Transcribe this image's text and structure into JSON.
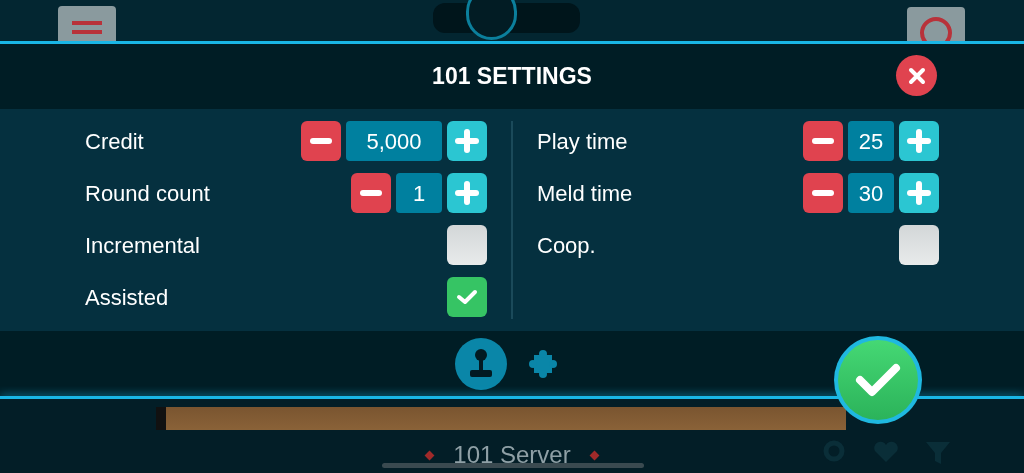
{
  "dialog": {
    "title": "101 SETTINGS"
  },
  "left_settings": [
    {
      "kind": "stepper",
      "label": "Credit",
      "value": "5,000"
    },
    {
      "kind": "stepper",
      "label": "Round count",
      "value": "1"
    },
    {
      "kind": "checkbox",
      "label": "Incremental",
      "checked": false
    },
    {
      "kind": "checkbox",
      "label": "Assisted",
      "checked": true
    }
  ],
  "right_settings": [
    {
      "kind": "stepper",
      "label": "Play time",
      "value": "25"
    },
    {
      "kind": "stepper",
      "label": "Meld time",
      "value": "30"
    },
    {
      "kind": "checkbox",
      "label": "Coop.",
      "checked": false
    }
  ],
  "tabs": [
    {
      "kind": "joystick",
      "selected": true
    },
    {
      "kind": "puzzle",
      "selected": false
    }
  ],
  "table": {
    "name": "101 Server"
  }
}
